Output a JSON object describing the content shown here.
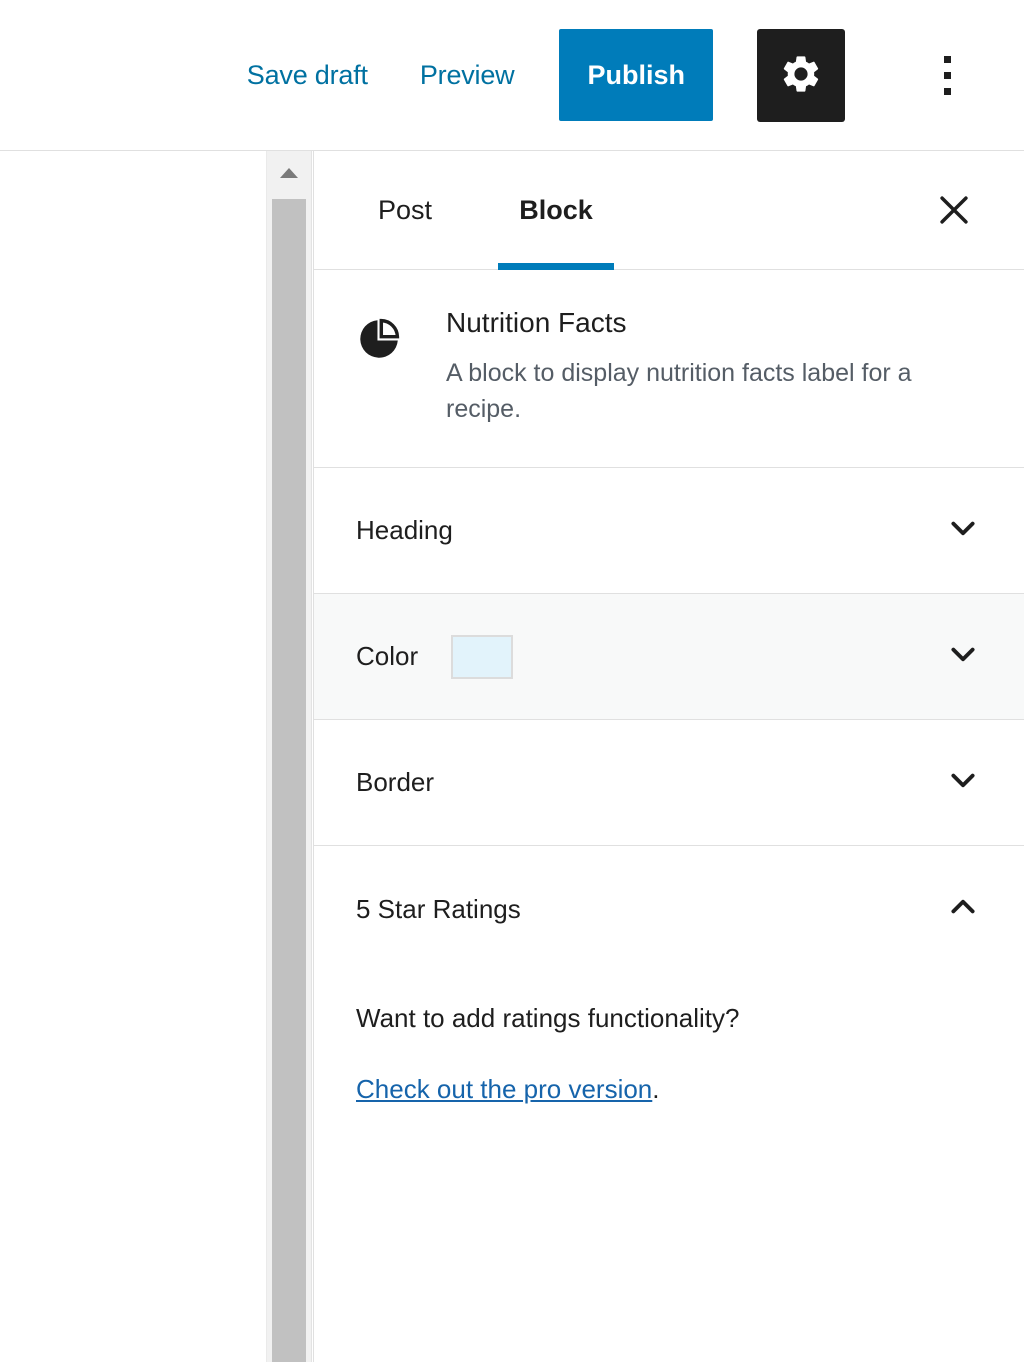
{
  "toolbar": {
    "save_draft_label": "Save draft",
    "preview_label": "Preview",
    "publish_label": "Publish",
    "settings_icon": "gear-icon",
    "more_options_icon": "kebab-menu-icon",
    "publish_color": "#007cba",
    "settings_button_color": "#1e1e1e",
    "link_color": "#0071a1"
  },
  "scrollbar": {
    "up_arrow_icon": "triangle-up-icon"
  },
  "sidebar": {
    "tabs": [
      {
        "label": "Post",
        "active": false
      },
      {
        "label": "Block",
        "active": true
      }
    ],
    "close_icon": "close-icon",
    "active_tab_indicator_color": "#007cba",
    "block_card": {
      "icon": "pie-chart-icon",
      "title": "Nutrition Facts",
      "description": "A block to display nutrition facts label for a recipe."
    },
    "panels": [
      {
        "title": "Heading",
        "expanded": false,
        "chevron": "chevron-down-icon",
        "shaded": false
      },
      {
        "title": "Color",
        "expanded": false,
        "chevron": "chevron-down-icon",
        "shaded": true,
        "swatch_color": "#e2f3fb"
      },
      {
        "title": "Border",
        "expanded": false,
        "chevron": "chevron-down-icon",
        "shaded": false
      },
      {
        "title": "5 Star Ratings",
        "expanded": true,
        "chevron": "chevron-up-icon",
        "shaded": false
      }
    ],
    "ratings_panel": {
      "question": "Want to add ratings functionality?",
      "link_text": "Check out the pro version",
      "link_suffix": ".",
      "link_color": "#1664ab"
    }
  }
}
